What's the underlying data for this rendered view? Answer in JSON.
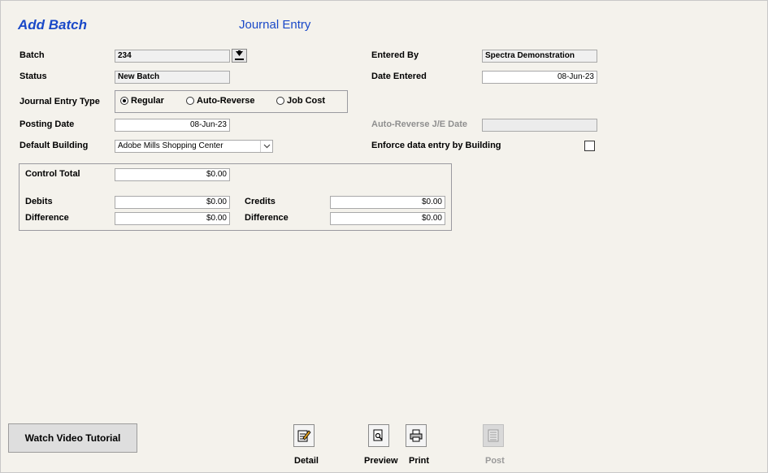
{
  "header": {
    "mode": "Add Batch",
    "title": "Journal Entry"
  },
  "form": {
    "batch_label": "Batch",
    "batch_value": "234",
    "status_label": "Status",
    "status_value": "New Batch",
    "entered_by_label": "Entered By",
    "entered_by_value": "Spectra Demonstration",
    "date_entered_label": "Date Entered",
    "date_entered_value": "08-Jun-23",
    "je_type_label": "Journal Entry Type",
    "je_type_options": [
      "Regular",
      "Auto-Reverse",
      "Job Cost"
    ],
    "je_type_selected": "Regular",
    "posting_date_label": "Posting Date",
    "posting_date_value": "08-Jun-23",
    "auto_reverse_label": "Auto-Reverse J/E Date",
    "auto_reverse_value": "",
    "default_building_label": "Default Building",
    "default_building_value": "Adobe Mills Shopping Center",
    "enforce_label": "Enforce data entry by Building",
    "enforce_checked": false
  },
  "totals": {
    "control_total_label": "Control Total",
    "control_total_value": "$0.00",
    "debits_label": "Debits",
    "debits_value": "$0.00",
    "credits_label": "Credits",
    "credits_value": "$0.00",
    "difference_label": "Difference",
    "debit_difference_value": "$0.00",
    "credit_difference_value": "$0.00"
  },
  "footer": {
    "video_label": "Watch Video Tutorial",
    "detail_label": "Detail",
    "preview_label": "Preview",
    "print_label": "Print",
    "post_label": "Post"
  },
  "icons": {
    "download": "download-arrow-icon",
    "detail": "edit-document-icon",
    "preview": "magnifier-page-icon",
    "print": "printer-icon",
    "post": "post-list-icon"
  },
  "colors": {
    "title": "#1a49c8",
    "background": "#f4f2ec"
  }
}
